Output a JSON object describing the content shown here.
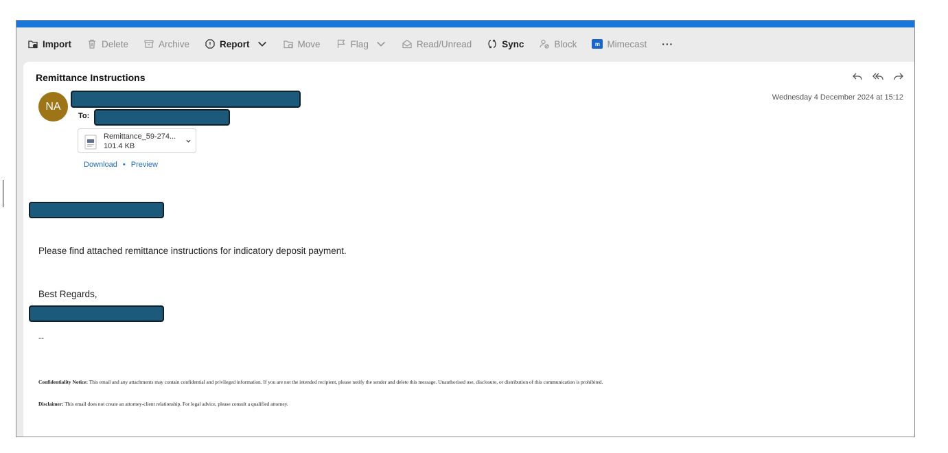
{
  "toolbar": {
    "items": [
      {
        "name": "import-button",
        "label": "Import",
        "icon": "import-icon",
        "bold": true
      },
      {
        "name": "delete-button",
        "label": "Delete",
        "icon": "trash-icon",
        "bold": false
      },
      {
        "name": "archive-button",
        "label": "Archive",
        "icon": "archive-icon",
        "bold": false
      },
      {
        "name": "report-button",
        "label": "Report",
        "icon": "report-icon",
        "bold": true
      },
      {
        "name": "move-button",
        "label": "Move",
        "icon": "move-icon",
        "bold": false
      },
      {
        "name": "flag-button",
        "label": "Flag",
        "icon": "flag-icon",
        "bold": false
      },
      {
        "name": "read-unread-button",
        "label": "Read/Unread",
        "icon": "envelope-open-icon",
        "bold": false
      },
      {
        "name": "sync-button",
        "label": "Sync",
        "icon": "sync-icon",
        "bold": true
      },
      {
        "name": "block-button",
        "label": "Block",
        "icon": "block-icon",
        "bold": false
      },
      {
        "name": "mimecast-button",
        "label": "Mimecast",
        "icon": "mimecast-icon",
        "bold": false
      }
    ],
    "more_label": "···"
  },
  "message": {
    "subject": "Remittance Instructions",
    "datetime": "Wednesday 4 December 2024 at 15:12",
    "avatar_initials": "NA",
    "to_label": "To:",
    "attachment": {
      "name": "Remittance_59-274...",
      "size": "101.4 KB",
      "download_label": "Download",
      "separator": "•",
      "preview_label": "Preview"
    },
    "body": {
      "line1": "Please find attached remittance instructions for indicatory deposit payment.",
      "closing": "Best Regards,",
      "signature_separator": "--"
    },
    "confidentiality": {
      "label": "Confidentiality Notice:",
      "text": " This email and any attachments may contain confidential and privileged information. If you are not the intended recipient, please notify the sender and delete this message. Unauthorised use, disclosure, or distribution of this communication is prohibited."
    },
    "disclaimer": {
      "label": "Disclaimer:",
      "text": " This email does not create an attorney-client relationship. For legal advice, please consult a qualified attorney."
    }
  },
  "colors": {
    "accent_bar": "#1877d8",
    "avatar_bg": "#9d7416",
    "redaction_fill": "#1b5a7a",
    "link": "#1f68c4"
  }
}
